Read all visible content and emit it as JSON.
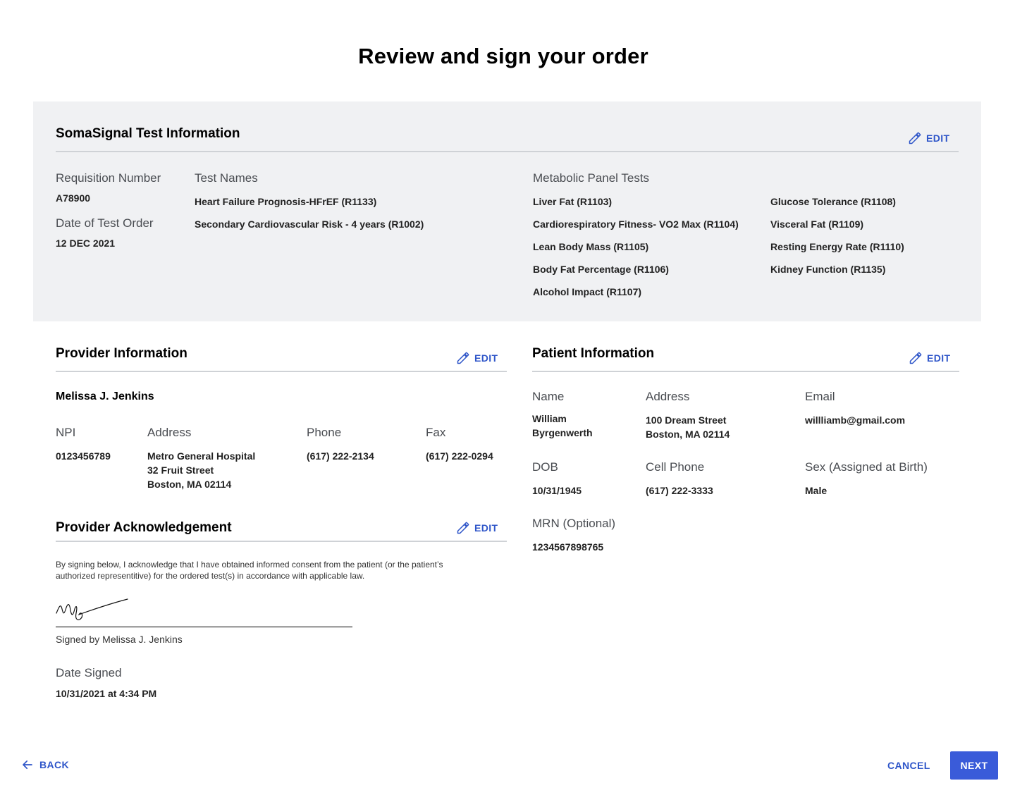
{
  "page": {
    "title": "Review and sign your order"
  },
  "colors": {
    "accent": "#3a5bd9",
    "panel_bg": "#f0f1f3",
    "rule": "#cfd2d6"
  },
  "test_info": {
    "title": "SomaSignal Test Information",
    "edit_label": "EDIT",
    "requisition_label": "Requisition Number",
    "requisition_value": "A78900",
    "date_label": "Date of Test Order",
    "date_value": "12 DEC 2021",
    "test_names_label": "Test Names",
    "test_names": [
      "Heart Failure Prognosis-HFrEF (R1133)",
      "Secondary Cardiovascular Risk - 4 years (R1002)"
    ],
    "metabolic_label": "Metabolic Panel Tests",
    "metabolic_col1": [
      "Liver Fat (R1103)",
      "Cardiorespiratory Fitness- VO2 Max (R1104)",
      "Lean Body Mass (R1105)",
      "Body Fat Percentage (R1106)",
      "Alcohol Impact (R1107)"
    ],
    "metabolic_col2": [
      "Glucose Tolerance (R1108)",
      "Visceral Fat (R1109)",
      "Resting Energy Rate (R1110)",
      "Kidney Function (R1135)"
    ]
  },
  "provider": {
    "title": "Provider Information",
    "edit_label": "EDIT",
    "name": "Melissa J. Jenkins",
    "npi_label": "NPI",
    "npi_value": "0123456789",
    "address_label": "Address",
    "address_lines": [
      "Metro General Hospital",
      "32 Fruit Street",
      "Boston, MA 02114"
    ],
    "phone_label": "Phone",
    "phone_value": "(617) 222-2134",
    "fax_label": "Fax",
    "fax_value": "(617) 222-0294"
  },
  "acknowledgement": {
    "title": "Provider Acknowledgement",
    "edit_label": "EDIT",
    "text_line1": "By signing below, I acknowledge that I have obtained informed consent from the patient (or the patient’s",
    "text_line2": "authorized representitive) for the ordered test(s) in accordance with  applicable law.",
    "signed_by": "Signed by Melissa J. Jenkins",
    "date_signed_label": "Date Signed",
    "date_signed_value": "10/31/2021 at 4:34 PM"
  },
  "patient": {
    "title": "Patient Information",
    "edit_label": "EDIT",
    "name_label": "Name",
    "name_lines": [
      "William",
      "Byrgenwerth"
    ],
    "address_label": "Address",
    "address_lines": [
      "100 Dream Street",
      "Boston, MA 02114"
    ],
    "email_label": "Email",
    "email_value": "willliamb@gmail.com",
    "dob_label": "DOB",
    "dob_value": "10/31/1945",
    "cell_label": "Cell Phone",
    "cell_value": "(617) 222-3333",
    "sex_label": "Sex (Assigned at Birth)",
    "sex_value": "Male",
    "mrn_label": "MRN (Optional)",
    "mrn_value": "1234567898765"
  },
  "footer": {
    "back_label": "BACK",
    "cancel_label": "CANCEL",
    "next_label": "NEXT"
  }
}
